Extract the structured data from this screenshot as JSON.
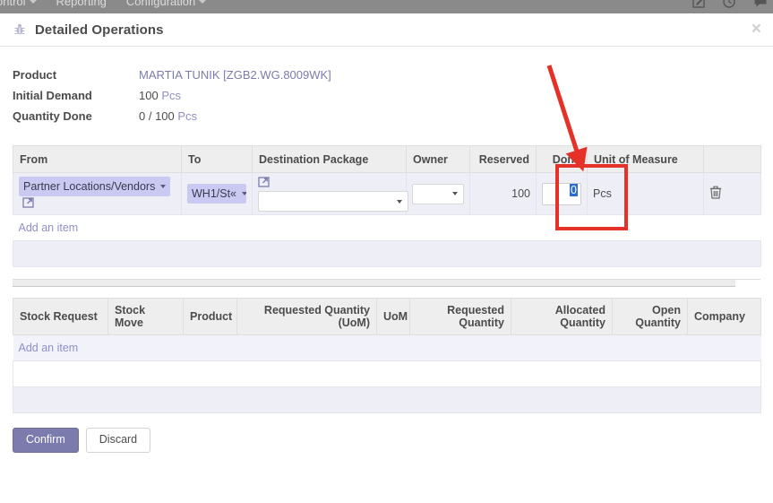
{
  "navbar": {
    "menus": [
      {
        "label": "ontrol",
        "caret": true
      },
      {
        "label": "Reporting",
        "caret": false
      },
      {
        "label": "Configuration",
        "caret": true
      }
    ],
    "icons": [
      "edit-pencil-icon",
      "clock-icon",
      "chat-bubble-icon"
    ]
  },
  "modal": {
    "icon": "bug-icon",
    "title": "Detailed Operations",
    "close_label": "×"
  },
  "info": {
    "rows": [
      {
        "label": "Product",
        "value": "MARTIA TUNIK [ZGB2.WG.8009WK]",
        "kind": "link"
      },
      {
        "label": "Initial Demand",
        "value": "100",
        "unit": "Pcs",
        "kind": "qty"
      },
      {
        "label": "Quantity Done",
        "value": "0 / 100",
        "unit": "Pcs",
        "kind": "qty"
      }
    ]
  },
  "operations_table": {
    "headers": [
      {
        "label": "From",
        "align": "left"
      },
      {
        "label": "To",
        "align": "left"
      },
      {
        "label": "Destination Package",
        "align": "left"
      },
      {
        "label": "Owner",
        "align": "left"
      },
      {
        "label": "Reserved",
        "align": "right"
      },
      {
        "label": "Done",
        "align": "right"
      },
      {
        "label": "Unit of Measure",
        "align": "left"
      },
      {
        "label": "",
        "align": "left"
      }
    ],
    "row": {
      "from": "Partner Locations/Vendors",
      "to": "WH1/St«",
      "destination_package": "",
      "owner": "",
      "reserved": "100",
      "done": "0",
      "unit_of_measure": "Pcs",
      "delete_icon": "trash-icon",
      "from_external_icon": "external-link-icon",
      "to_external_icon": "external-link-icon"
    },
    "add_item_label": "Add an item"
  },
  "stock_table": {
    "headers": [
      {
        "label": "Stock Request",
        "align": "left"
      },
      {
        "label": "Stock Move",
        "align": "left"
      },
      {
        "label": "Product",
        "align": "left"
      },
      {
        "label": "Requested Quantity (UoM)",
        "align": "right"
      },
      {
        "label": "UoM",
        "align": "left"
      },
      {
        "label": "Requested Quantity",
        "align": "right"
      },
      {
        "label": "Allocated Quantity",
        "align": "right"
      },
      {
        "label": "Open Quantity",
        "align": "right"
      },
      {
        "label": "Company",
        "align": "left"
      }
    ],
    "rows": [],
    "add_item_label": "Add an item"
  },
  "footer": {
    "confirm_label": "Confirm",
    "discard_label": "Discard"
  },
  "annotation": {
    "box_color": "#e53228",
    "arrow_color": "#e53228",
    "target": "done-field"
  }
}
